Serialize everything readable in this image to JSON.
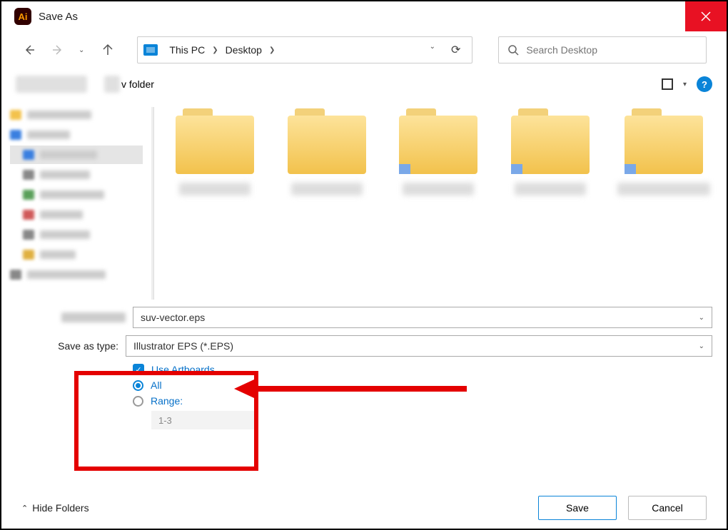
{
  "title": "Save As",
  "breadcrumb": {
    "l1": "This PC",
    "l2": "Desktop"
  },
  "search": {
    "placeholder": "Search Desktop"
  },
  "toolbar": {
    "new_folder": "v folder"
  },
  "file": {
    "name": "suv-vector.eps",
    "type_label": "Save as type:",
    "type_value": "Illustrator EPS (*.EPS)"
  },
  "artboards": {
    "use_label": "Use Artboards",
    "all_label": "All",
    "range_label": "Range:",
    "range_value": "1-3"
  },
  "footer": {
    "hide_folders": "Hide Folders",
    "save": "Save",
    "cancel": "Cancel"
  }
}
